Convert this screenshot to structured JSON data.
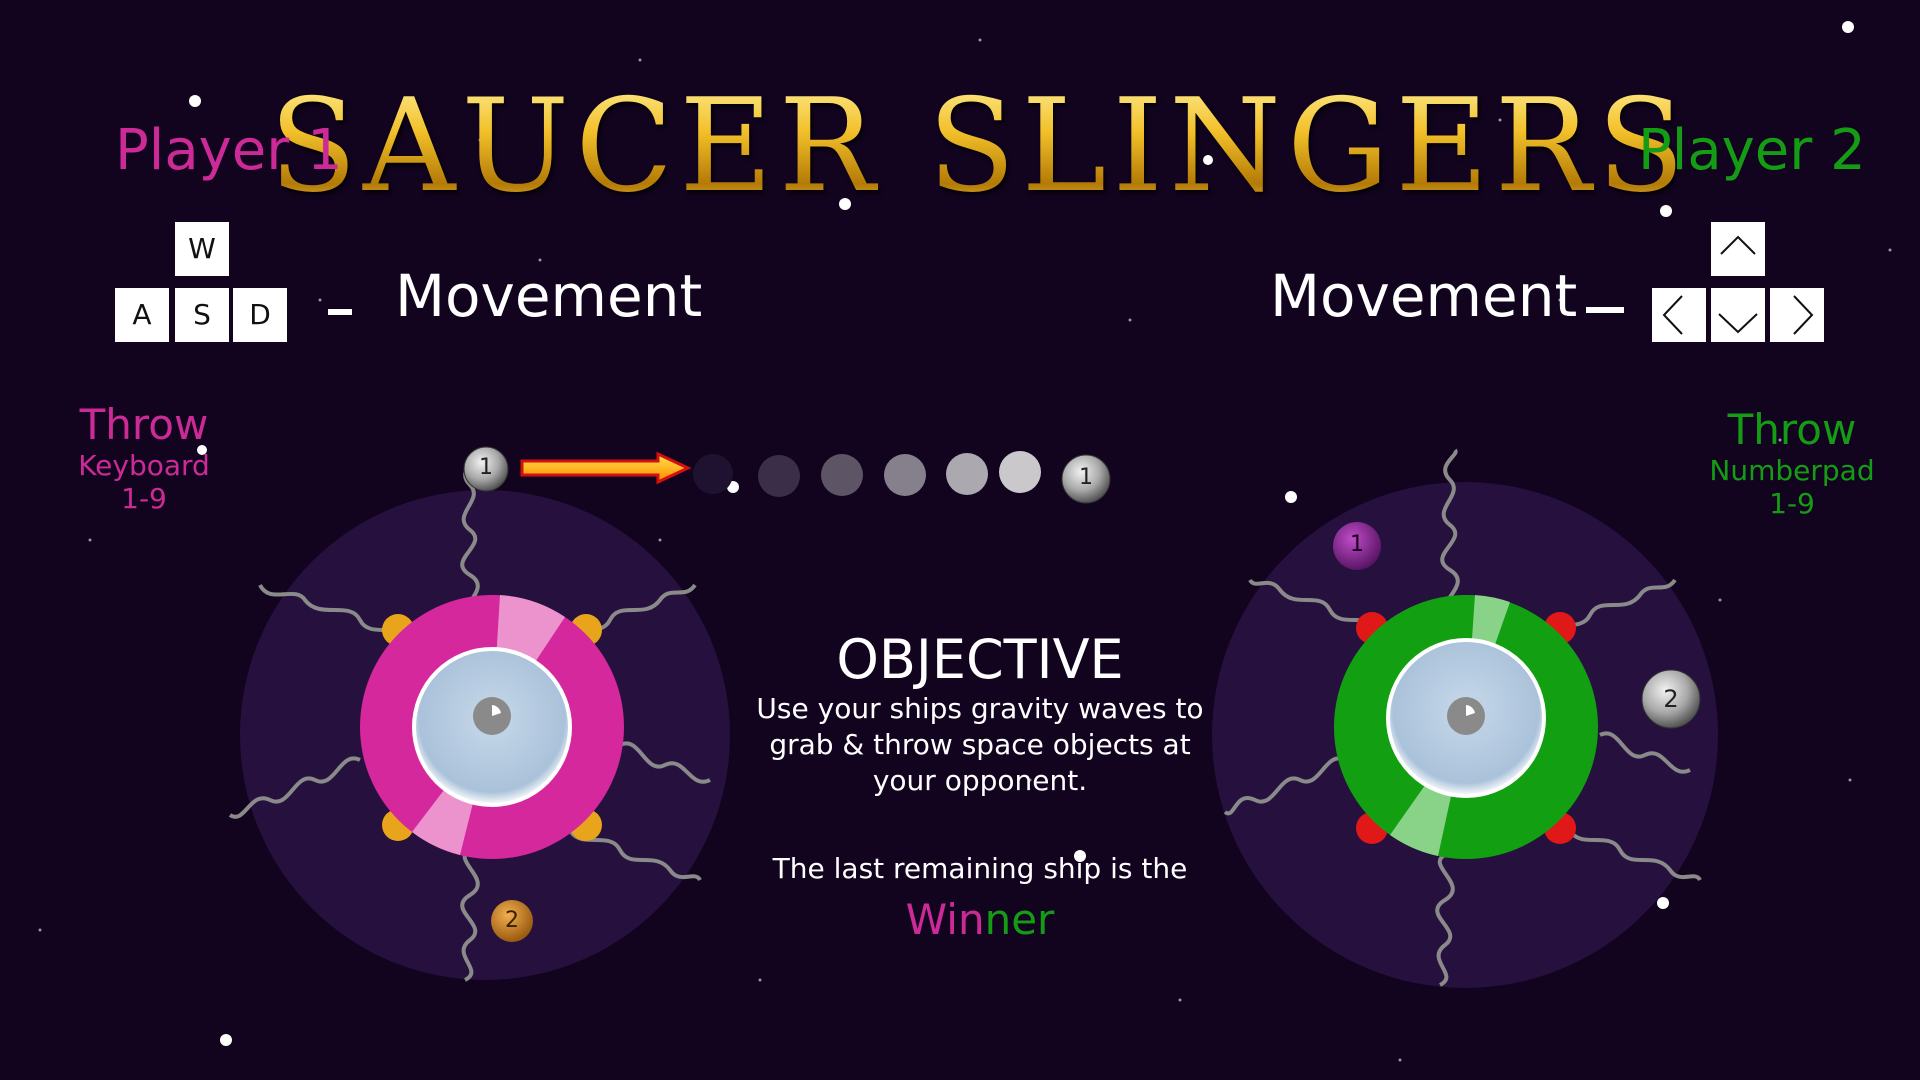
{
  "title": "SAUCER SLINGERS",
  "player1": {
    "label": "Player 1",
    "keys": [
      "W",
      "A",
      "S",
      "D"
    ],
    "movement_label": "Movement",
    "throw_label": "Throw",
    "throw_device": "Keyboard",
    "throw_keys": "1-9",
    "ship_color": "#d4289c",
    "pod_color": "#e8a51c"
  },
  "player2": {
    "label": "Player 2",
    "keys": [
      "up-arrow-key",
      "left-arrow-key",
      "down-arrow-key",
      "right-arrow-key"
    ],
    "movement_label": "Movement",
    "throw_label": "Throw",
    "throw_device": "Numberpad",
    "throw_keys": "1-9",
    "ship_color": "#12a012",
    "pod_color": "#e01818"
  },
  "objective": {
    "heading": "OBJECTIVE",
    "lines": [
      "Use your ships gravity waves to",
      "grab & throw space objects at",
      "your opponent."
    ],
    "last_line": "The last remaining ship is the",
    "winner_part1": "Win",
    "winner_part2": "ner"
  },
  "space_objects": [
    {
      "label": "1",
      "kind": "moon"
    },
    {
      "label": "1",
      "kind": "moon"
    },
    {
      "label": "2",
      "kind": "asteroid"
    },
    {
      "label": "1",
      "kind": "purple-rock"
    },
    {
      "label": "2",
      "kind": "moon"
    }
  ],
  "colors": {
    "background": "#12041f",
    "gravity_field": "#26103e",
    "title_gold": "#e6b018",
    "player1": "#cc2a96",
    "player2": "#149d14",
    "arrow": "#e8b000"
  }
}
